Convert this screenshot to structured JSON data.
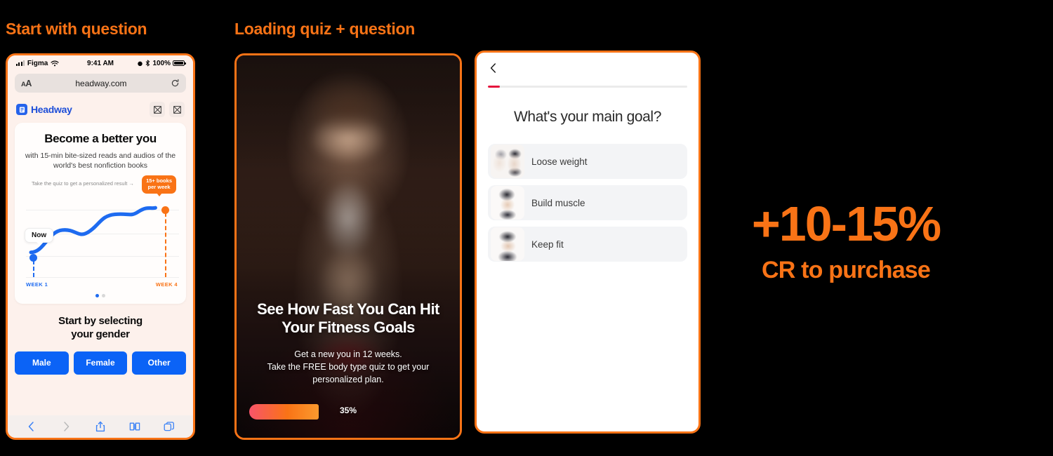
{
  "sections": {
    "left_caption": "Start with question",
    "mid_caption": "Loading quiz + question"
  },
  "phone1": {
    "status_bar": {
      "carrier": "Figma",
      "time": "9:41 AM",
      "battery": "100%"
    },
    "browser": {
      "text_size_label": "AA",
      "url": "headway.com",
      "reload_icon": "reload-icon"
    },
    "site": {
      "brand": "Headway",
      "headline": "Become a better you",
      "subhead": "with 15-min bite-sized reads and audios of the world's best nonfiction books",
      "chart": {
        "hint": "Take the quiz to get a personalized result →",
        "badge_line1": "15+ books",
        "badge_line2": "per week",
        "now_label": "Now",
        "week_start": "WEEK 1",
        "week_end": "WEEK 4"
      },
      "gender_title_line1": "Start by selecting",
      "gender_title_line2": "your gender",
      "gender_buttons": [
        "Male",
        "Female",
        "Other"
      ]
    },
    "toolbar_icons": [
      "back-icon",
      "forward-icon",
      "share-icon",
      "bookmarks-icon",
      "tabs-icon"
    ]
  },
  "phone2": {
    "title_line1": "See How Fast You Can Hit",
    "title_line2": "Your Fitness Goals",
    "sub_line1": "Get a new you in 12 weeks.",
    "sub_line2": "Take the FREE body type quiz to get your",
    "sub_line3": "personalized plan.",
    "progress_percent": "35%",
    "progress_value": 35
  },
  "phone3": {
    "back_icon": "chevron-left-icon",
    "progress_value": 6,
    "question": "What's your main goal?",
    "options": [
      {
        "label": "Loose weight",
        "thumb": "body-slim-thumb"
      },
      {
        "label": "Build muscle",
        "thumb": "body-muscle-thumb"
      },
      {
        "label": "Keep fit",
        "thumb": "body-fit-thumb"
      }
    ]
  },
  "stat": {
    "value": "+10-15%",
    "label": "CR to purchase"
  },
  "chart_data": {
    "type": "line",
    "title": "Reading progress projection",
    "x": [
      "WEEK 1",
      "WEEK 4"
    ],
    "series": [
      {
        "name": "books per week",
        "values": [
          1,
          15
        ]
      }
    ],
    "annotations": [
      "Now",
      "15+ books per week"
    ],
    "xlabel": "",
    "ylabel": "",
    "grid": true,
    "legend": "none"
  },
  "colors": {
    "accent_orange": "#F97316",
    "brand_blue": "#1D4ED8",
    "button_blue": "#0B63F6",
    "progress_red": "#E5123C",
    "page_cream": "#FDF1EC"
  }
}
